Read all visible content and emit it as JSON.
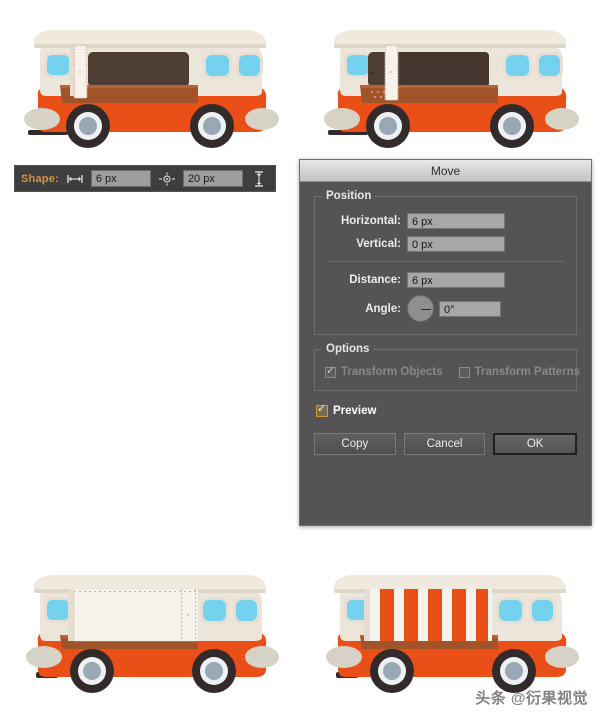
{
  "app": {
    "illustrations": [
      {
        "name": "van-top-left",
        "description": "Orange and cream retro food van, side view, open serving window with brown counter, white door panel on left of counter"
      },
      {
        "name": "van-top-right",
        "description": "Same van with door panel shifted 6px right, dotted rivet marks visible on counter"
      },
      {
        "name": "van-bottom-left",
        "description": "Van with large white panel covering the serving window area"
      },
      {
        "name": "van-bottom-right",
        "description": "Van with orange and white vertical striped awning over the serving window"
      }
    ]
  },
  "shape_toolbar": {
    "label": "Shape:",
    "horizontal_icon": "horizontal-distance-icon",
    "horizontal_value": "6 px",
    "spacing_icon": "rivet-spacing-icon",
    "spacing_value": "20 px",
    "vertical_icon": "vertical-distance-icon"
  },
  "move_dialog": {
    "title": "Move",
    "position_group": {
      "legend": "Position",
      "fields": [
        {
          "label": "Horizontal:",
          "value": "6 px"
        },
        {
          "label": "Vertical:",
          "value": "0 px"
        },
        {
          "label": "Distance:",
          "value": "6 px"
        },
        {
          "label": "Angle:",
          "value": "0°"
        }
      ]
    },
    "options_group": {
      "legend": "Options",
      "transform_objects": {
        "label": "Transform Objects",
        "checked": true,
        "enabled": false
      },
      "transform_patterns": {
        "label": "Transform Patterns",
        "checked": false,
        "enabled": false
      }
    },
    "preview": {
      "label": "Preview",
      "checked": true,
      "accent": "#c99a3c"
    },
    "buttons": {
      "copy": "Copy",
      "cancel": "Cancel",
      "ok": "OK"
    }
  },
  "watermark": {
    "text": "头条 @衍果视觉"
  },
  "palette": {
    "van_body_orange": "#ea4f17",
    "van_roof_cream": "#ece5da",
    "van_window_blue": "#74d2ef",
    "van_counter_brown": "#a1542a",
    "van_interior_dark": "#4d3d33",
    "wheel_dark": "#332b2b",
    "wheel_hub": "#9aa7b4",
    "dialog_bg": "#545454",
    "accent_orange": "#d89040"
  }
}
